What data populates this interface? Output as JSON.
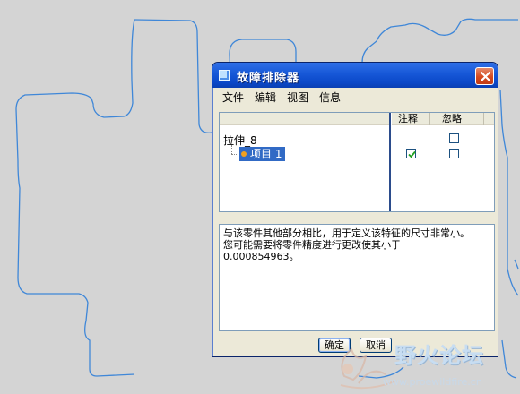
{
  "dialog": {
    "title": "故障排除器",
    "close_glyph": "×"
  },
  "menu": [
    "文件",
    "编辑",
    "视图",
    "信息"
  ],
  "tree": {
    "columns": [
      "注释",
      "忽略"
    ],
    "root_label": "拉伸_8",
    "child_label": "项目 1",
    "rows": [
      {
        "annotate": false,
        "ignore": false
      },
      {
        "annotate": true,
        "ignore": false
      }
    ]
  },
  "message": "与该零件其他部分相比，用于定义该特征的尺寸非常小。\n您可能需要将零件精度进行更改使其小于\n0.000854963。",
  "buttons": {
    "ok": "确定",
    "cancel": "取消"
  },
  "watermark": {
    "text": "野火论坛",
    "url": "www.proewildfire.cn"
  },
  "colors": {
    "sketch_line": "#3f87d8",
    "titlebar": "#0b48c8",
    "selection": "#316ac5"
  },
  "icons": [
    "dialog-app-icon",
    "close-icon",
    "tree-node-dot-icon",
    "checkmark-icon"
  ]
}
